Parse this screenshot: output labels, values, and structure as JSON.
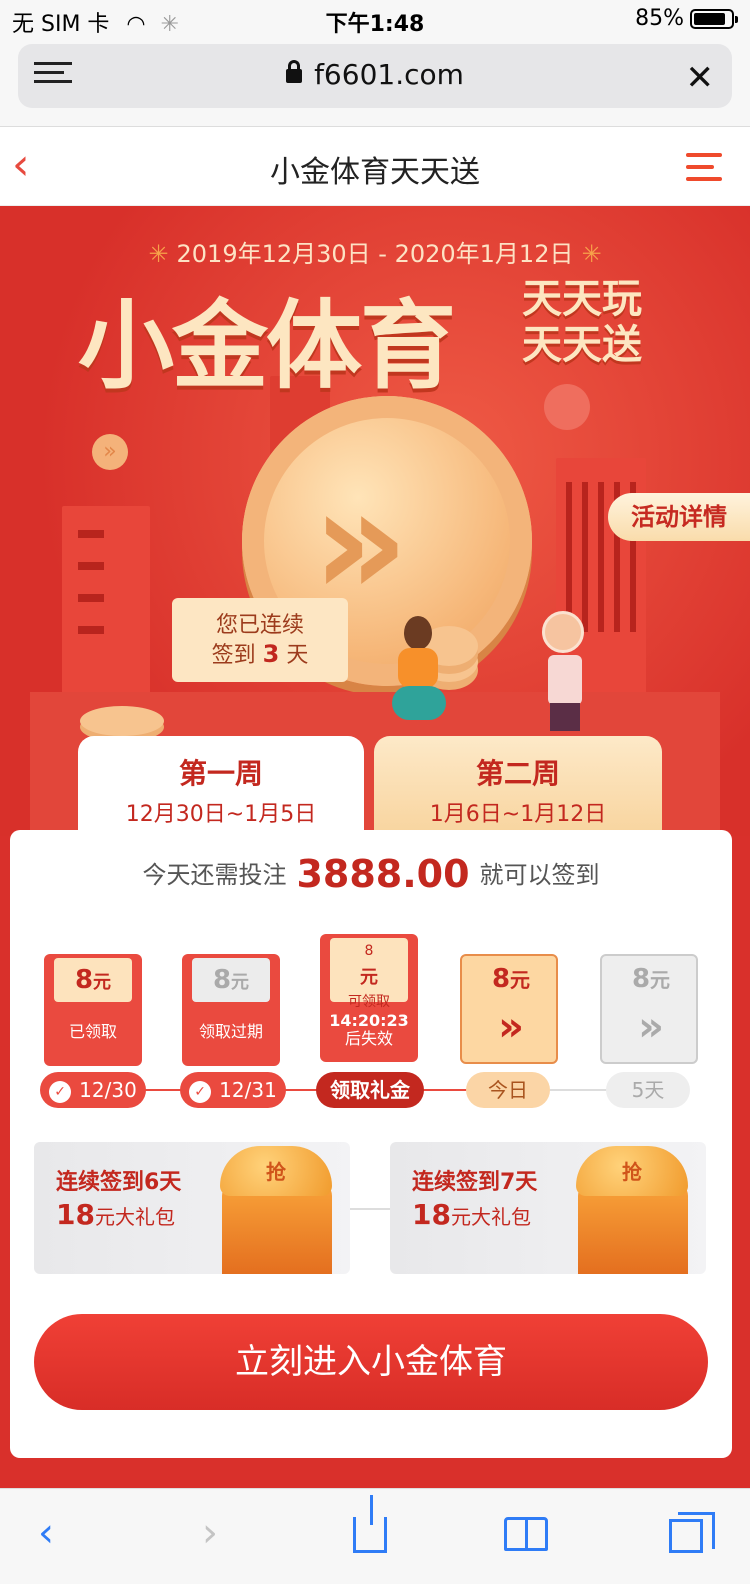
{
  "status": {
    "carrier": "无 SIM 卡",
    "time": "下午1:48",
    "battery": "85%",
    "battery_level": 0.85
  },
  "browser": {
    "url": "f6601.com"
  },
  "nav": {
    "title": "小金体育天天送"
  },
  "banner": {
    "date_range": "2019年12月30日 - 2020年1月12日",
    "title": "小金体育",
    "side_line1": "天天玩",
    "side_line2": "天天送",
    "details_button": "活动详情",
    "checkin_line1": "您已连续",
    "checkin_prefix": "签到",
    "checkin_days": "3",
    "checkin_suffix": "天"
  },
  "weeks": [
    {
      "title": "第一周",
      "range": "12月30日~1月5日"
    },
    {
      "title": "第二周",
      "range": "1月6日~1月12日"
    }
  ],
  "card": {
    "need_prefix": "今天还需投注",
    "need_amount": "3888.00",
    "need_suffix": "就可以签到",
    "days": [
      {
        "amount": "8",
        "unit": "元",
        "label": "已领取",
        "pill": "12/30"
      },
      {
        "amount": "8",
        "unit": "元",
        "label": "领取过期",
        "pill": "12/31"
      },
      {
        "amount": "8",
        "unit": "元",
        "sub": "可领取",
        "countdown": "14:20:23",
        "label": "后失效",
        "pill": "领取礼金"
      },
      {
        "amount": "8",
        "unit": "元",
        "pill": "今日"
      },
      {
        "amount": "8",
        "unit": "元",
        "pill": "5天"
      }
    ],
    "gifts": [
      {
        "title": "连续签到6天",
        "amount": "18",
        "unit": "元",
        "desc": "大礼包",
        "lid": "抢"
      },
      {
        "title": "连续签到7天",
        "amount": "18",
        "unit": "元",
        "desc": "大礼包",
        "lid": "抢"
      }
    ],
    "cta": "立刻进入小金体育"
  },
  "colors": {
    "brand_red": "#d9302b",
    "accent_gold": "#fde6c1",
    "ios_blue": "#2f7cf6"
  },
  "icons": [
    "wifi-icon",
    "loading-icon",
    "battery-icon",
    "menu-icon",
    "lock-icon",
    "close-icon",
    "back-icon",
    "hamburger-icon",
    "share-icon",
    "bookmarks-icon",
    "tabs-icon",
    "forward-icon"
  ]
}
